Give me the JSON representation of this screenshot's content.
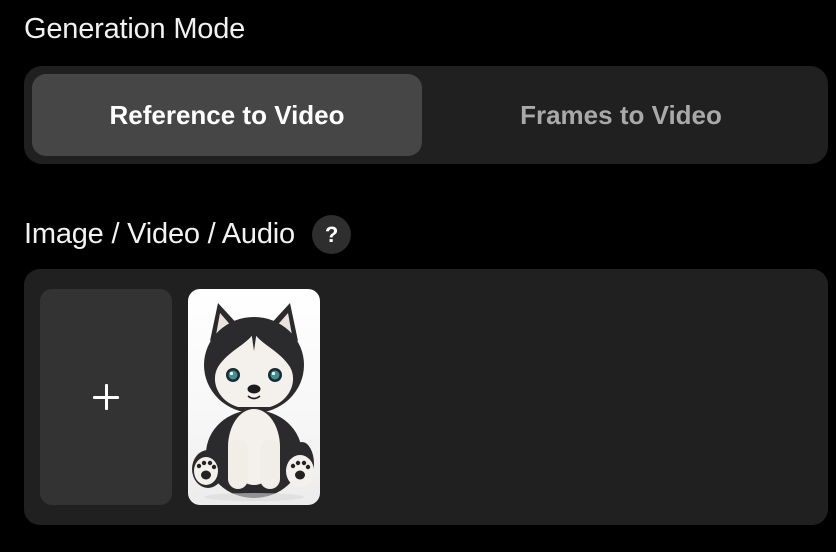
{
  "generation_mode": {
    "title": "Generation Mode",
    "options": [
      {
        "label": "Reference to Video",
        "selected": true
      },
      {
        "label": "Frames to Video",
        "selected": false
      }
    ]
  },
  "media": {
    "title": "Image / Video / Audio",
    "help_glyph": "?",
    "help_icon": "question-mark-icon",
    "add_icon": "plus-icon",
    "items": [
      {
        "type": "image",
        "subject": "plush husky puppy toy"
      }
    ]
  },
  "colors": {
    "background": "#000000",
    "panel": "#202020",
    "selected_option": "#464646",
    "inactive_text": "#a9a9a9",
    "add_tile": "#333333"
  }
}
